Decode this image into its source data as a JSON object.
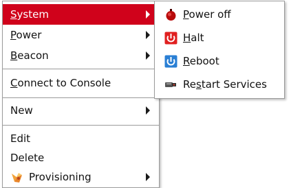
{
  "main_menu": {
    "items": [
      {
        "pre": "",
        "ul": "S",
        "post": "ystem"
      },
      {
        "pre": "",
        "ul": "P",
        "post": "ower"
      },
      {
        "pre": "",
        "ul": "B",
        "post": "eacon"
      },
      {
        "pre": "",
        "ul": "C",
        "post": "onnect to Console"
      },
      {
        "text": "New"
      },
      {
        "text": "Edit"
      },
      {
        "text": "Delete"
      },
      {
        "text": "Provisioning"
      }
    ]
  },
  "sub_menu": {
    "items": [
      {
        "pre": "",
        "ul": "P",
        "post": "ower off",
        "icon": "power-off-icon"
      },
      {
        "pre": "",
        "ul": "H",
        "post": "alt",
        "icon": "halt-icon"
      },
      {
        "pre": "",
        "ul": "R",
        "post": "eboot",
        "icon": "reboot-icon"
      },
      {
        "pre": "Re",
        "ul": "s",
        "post": "tart Services",
        "icon": "restart-services-icon"
      }
    ]
  },
  "colors": {
    "highlight": "#d0021b",
    "halt_icon": "#e02020",
    "reboot_icon": "#2a7fd4"
  }
}
